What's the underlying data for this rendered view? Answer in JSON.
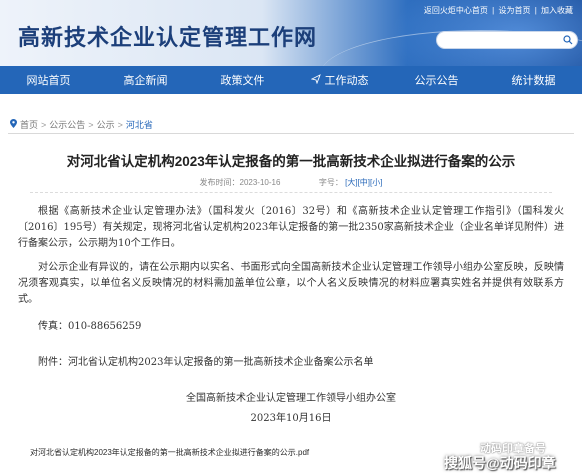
{
  "header": {
    "site_title": "高新技术企业认定管理工作网",
    "top_links": [
      "返回火炬中心首页",
      "设为首页",
      "加入收藏"
    ],
    "top_links_separator": "|",
    "search_placeholder": ""
  },
  "nav": {
    "items": [
      {
        "label": "网站首页",
        "icon": ""
      },
      {
        "label": "高企新闻",
        "icon": ""
      },
      {
        "label": "政策文件",
        "icon": ""
      },
      {
        "label": "工作动态",
        "icon": "paper-plane-icon"
      },
      {
        "label": "公示公告",
        "icon": ""
      },
      {
        "label": "统计数据",
        "icon": ""
      }
    ]
  },
  "breadcrumb": {
    "items": [
      "首页",
      "公示公告",
      "公示",
      "河北省"
    ],
    "separator": ">"
  },
  "article": {
    "title": "对河北省认定机构2023年认定报备的第一批高新技术企业拟进行备案的公示",
    "meta_date_label": "发布时间：",
    "meta_date": "2023-10-16",
    "meta_font_label": "字号：",
    "font_sizes": [
      "[大]",
      "[中]",
      "[小]"
    ],
    "paragraph1": "根据《高新技术企业认定管理办法》（国科发火〔2016〕32号）和《高新技术企业认定管理工作指引》（国科发火〔2016〕195号）有关规定，现将河北省认定机构2023年认定报备的第一批2350家高新技术企业（企业名单详见附件）进行备案公示，公示期为10个工作日。",
    "paragraph2": "对公示企业有异议的，请在公示期内以实名、书面形式向全国高新技术企业认定管理工作领导小组办公室反映，反映情况须客观真实，以单位名义反映情况的材料需加盖单位公章，以个人名义反映情况的材料应署真实姓名并提供有效联系方式。",
    "contact": "传真：010-88656259",
    "attachment": "附件：河北省认定机构2023年认定报备的第一批高新技术企业备案公示名单",
    "signature": "全国高新技术企业认定管理工作领导小组办公室",
    "signature_date": "2023年10月16日",
    "pdf_link": "对河北省认定机构2023年认定报备的第一批高新技术企业拟进行备案的公示.pdf"
  },
  "watermark": {
    "line1": "动码印章备号",
    "line2": "搜狐号@动码印章"
  },
  "colors": {
    "nav_bg": "#2466b8",
    "title_blue": "#1c3f7a",
    "link_blue": "#2466b8"
  }
}
